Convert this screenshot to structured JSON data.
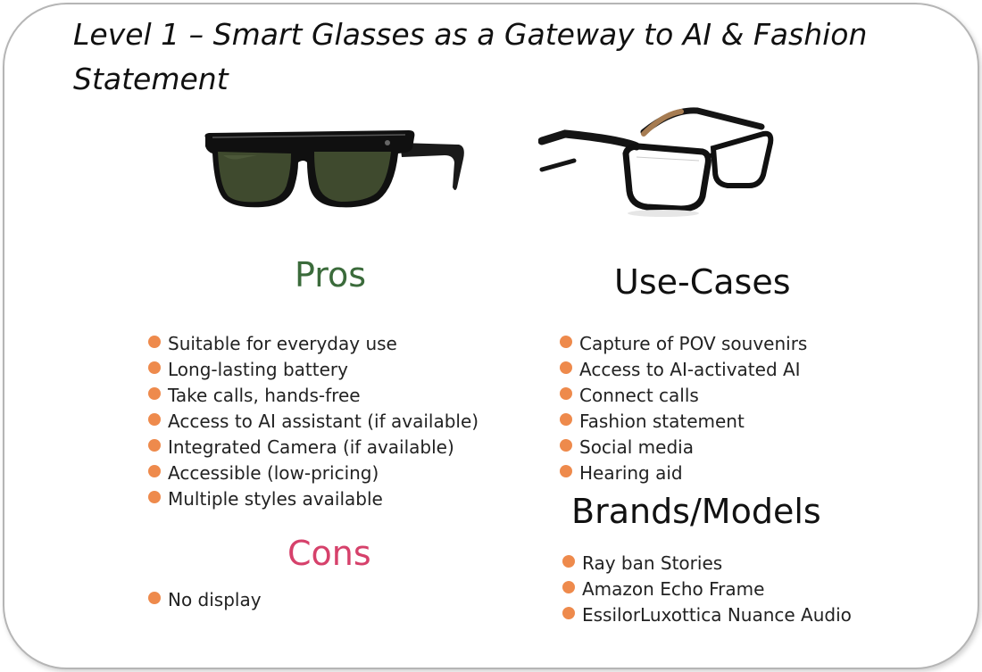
{
  "title": "Level 1 – Smart Glasses as a Gateway to AI & Fashion Statement",
  "images": {
    "left": "sunglasses-icon",
    "right": "eyeglasses-icon"
  },
  "pros": {
    "heading": "Pros",
    "items": [
      "Suitable for everyday use",
      "Long-lasting battery",
      "Take calls, hands-free",
      "Access to AI assistant (if available)",
      "Integrated Camera (if available)",
      "Accessible (low-pricing)",
      "Multiple styles available"
    ]
  },
  "cons": {
    "heading": "Cons",
    "items": [
      "No display"
    ]
  },
  "use_cases": {
    "heading": "Use-Cases",
    "items": [
      "Capture of POV souvenirs",
      "Access to AI-activated AI",
      "Connect calls",
      "Fashion statement",
      "Social media",
      "Hearing aid"
    ]
  },
  "brands": {
    "heading": "Brands/Models",
    "items": [
      "Ray ban Stories",
      "Amazon Echo Frame",
      "EssilorLuxottica Nuance Audio"
    ]
  },
  "colors": {
    "pros": "#3b6b3b",
    "cons": "#d6416b",
    "bullet": "#ee8a4c",
    "border": "#b5b5b5"
  }
}
